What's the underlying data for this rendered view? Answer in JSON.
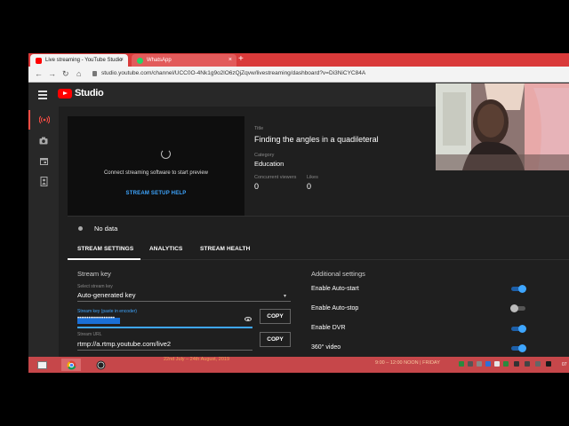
{
  "browser": {
    "tabs": [
      {
        "label": "Live streaming - YouTube Studio",
        "close": "×",
        "favicon_color": "#ff0000"
      },
      {
        "label": "WhatsApp",
        "close": "×",
        "favicon_color": "#25d366"
      }
    ],
    "new_tab": "+",
    "url": "studio.youtube.com/channel/UCC0O-4Nk1g9o2lO6zQjZqvw/livestreaming/dashboard?v=Di3NiCYC84A"
  },
  "header": {
    "brand": "Studio"
  },
  "preview": {
    "message": "Connect streaming software to start preview",
    "help_link": "STREAM SETUP HELP"
  },
  "info": {
    "title_label": "Title",
    "title_value": "Finding the angles in a quadileteral",
    "category_label": "Category",
    "category_value": "Education",
    "viewers_label": "Concurrent viewers",
    "viewers_value": "0",
    "likes_label": "Likes",
    "likes_value": "0"
  },
  "status": {
    "text": "No data"
  },
  "tabs": [
    "STREAM SETTINGS",
    "ANALYTICS",
    "STREAM HEALTH"
  ],
  "stream_key": {
    "heading": "Stream key",
    "select_label": "Select stream key",
    "select_value": "Auto-generated key",
    "key_label": "Stream key (paste in encoder)",
    "key_masked": "••••••••••••••••••••",
    "url_label": "Stream URL",
    "url_value": "rtmp://a.rtmp.youtube.com/live2",
    "copy_label": "COPY"
  },
  "additional": {
    "heading": "Additional settings",
    "items": [
      {
        "label": "Enable Auto-start",
        "on": true
      },
      {
        "label": "Enable Auto-stop",
        "on": false
      },
      {
        "label": "Enable DVR",
        "on": true
      },
      {
        "label": "360° video",
        "on": true
      }
    ]
  },
  "taskbar": {
    "banner_left": "22nd July – 24th August, 2019",
    "banner_right_1": "9:00 – 12:00 NOON | FRIDAY",
    "clock": "07"
  },
  "colors": {
    "accent": "#3ea6ff",
    "brand_red": "#ff0000",
    "taskbar": "#c6474a"
  }
}
